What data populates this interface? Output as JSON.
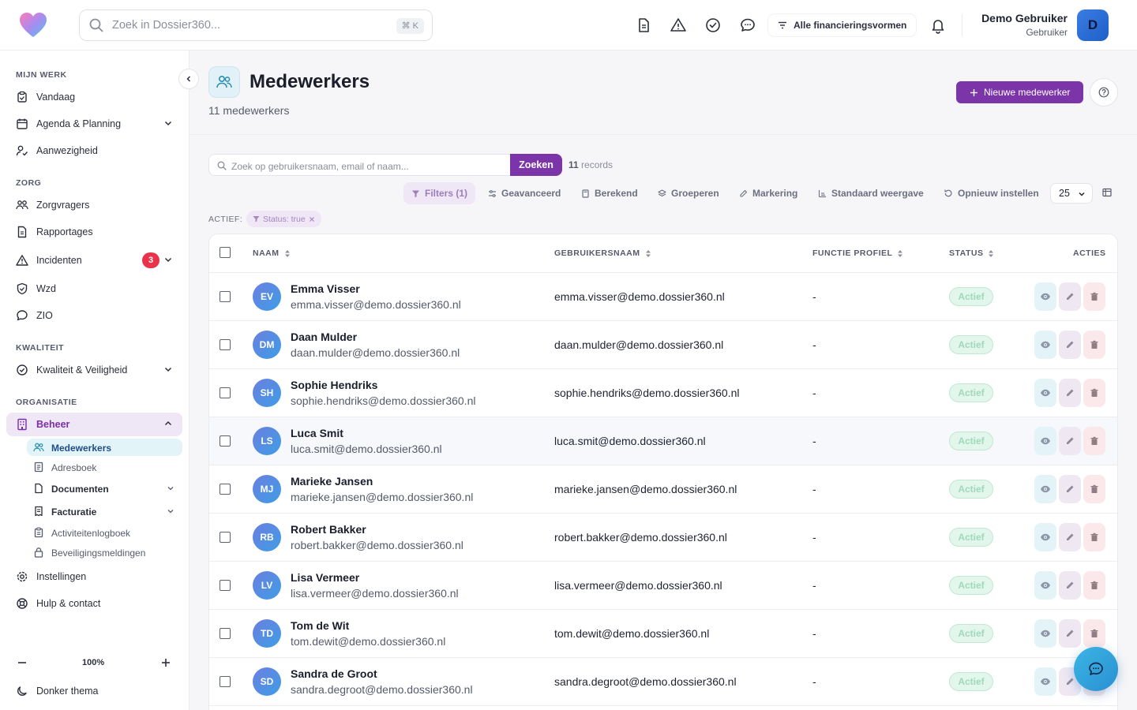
{
  "header": {
    "search_placeholder": "Zoek in Dossier360...",
    "search_shortcut": "⌘ K",
    "financing_label": "Alle financieringsvormen",
    "user_name": "Demo Gebruiker",
    "user_role": "Gebruiker",
    "user_initial": "D"
  },
  "sidebar": {
    "sections": {
      "mijn_werk": "MIJN WERK",
      "zorg": "ZORG",
      "kwaliteit": "KWALITEIT",
      "organisatie": "ORGANISATIE"
    },
    "items": {
      "vandaag": "Vandaag",
      "agenda": "Agenda & Planning",
      "aanwezigheid": "Aanwezigheid",
      "zorgvragers": "Zorgvragers",
      "rapportages": "Rapportages",
      "incidenten": "Incidenten",
      "incidenten_badge": "3",
      "wzd": "Wzd",
      "zio": "ZIO",
      "kwaliteit": "Kwaliteit & Veiligheid",
      "beheer": "Beheer",
      "instellingen": "Instellingen",
      "hulp": "Hulp & contact"
    },
    "sub_items": {
      "medewerkers": "Medewerkers",
      "adresboek": "Adresboek",
      "documenten": "Documenten",
      "facturatie": "Facturatie",
      "activiteiten": "Activiteitenlogboek",
      "beveiliging": "Beveiligingsmeldingen"
    },
    "zoom": "100%",
    "dark_theme": "Donker thema"
  },
  "page": {
    "title": "Medewerkers",
    "subtitle": "11 medewerkers",
    "new_button": "Nieuwe medewerker"
  },
  "toolbar": {
    "search_placeholder": "Zoek op gebruikersnaam, email of naam...",
    "search_button": "Zoeken",
    "records_count": "11",
    "records_label": "records",
    "filters": "Filters (1)",
    "geavanceerd": "Geavanceerd",
    "berekend": "Berekend",
    "groeperen": "Groeperen",
    "markering": "Markering",
    "standaard": "Standaard weergave",
    "opnieuw": "Opnieuw instellen",
    "page_size": "25",
    "active_label": "ACTIEF:",
    "active_chip": "Status: true"
  },
  "table": {
    "columns": {
      "naam": "NAAM",
      "gebruikersnaam": "GEBRUIKERSNAAM",
      "functie": "FUNCTIE PROFIEL",
      "status": "STATUS",
      "acties": "ACTIES"
    },
    "rows": [
      {
        "initials": "EV",
        "name": "Emma Visser",
        "email": "emma.visser@demo.dossier360.nl",
        "username": "emma.visser@demo.dossier360.nl",
        "function": "-",
        "status": "Actief"
      },
      {
        "initials": "DM",
        "name": "Daan Mulder",
        "email": "daan.mulder@demo.dossier360.nl",
        "username": "daan.mulder@demo.dossier360.nl",
        "function": "-",
        "status": "Actief"
      },
      {
        "initials": "SH",
        "name": "Sophie Hendriks",
        "email": "sophie.hendriks@demo.dossier360.nl",
        "username": "sophie.hendriks@demo.dossier360.nl",
        "function": "-",
        "status": "Actief"
      },
      {
        "initials": "LS",
        "name": "Luca Smit",
        "email": "luca.smit@demo.dossier360.nl",
        "username": "luca.smit@demo.dossier360.nl",
        "function": "-",
        "status": "Actief"
      },
      {
        "initials": "MJ",
        "name": "Marieke Jansen",
        "email": "marieke.jansen@demo.dossier360.nl",
        "username": "marieke.jansen@demo.dossier360.nl",
        "function": "-",
        "status": "Actief"
      },
      {
        "initials": "RB",
        "name": "Robert Bakker",
        "email": "robert.bakker@demo.dossier360.nl",
        "username": "robert.bakker@demo.dossier360.nl",
        "function": "-",
        "status": "Actief"
      },
      {
        "initials": "LV",
        "name": "Lisa Vermeer",
        "email": "lisa.vermeer@demo.dossier360.nl",
        "username": "lisa.vermeer@demo.dossier360.nl",
        "function": "-",
        "status": "Actief"
      },
      {
        "initials": "TD",
        "name": "Tom de Wit",
        "email": "tom.dewit@demo.dossier360.nl",
        "username": "tom.dewit@demo.dossier360.nl",
        "function": "-",
        "status": "Actief"
      },
      {
        "initials": "SD",
        "name": "Sandra de Groot",
        "email": "sandra.degroot@demo.dossier360.nl",
        "username": "sandra.degroot@demo.dossier360.nl",
        "function": "-",
        "status": "Actief"
      }
    ]
  },
  "colors": {
    "brand_purple": "#7b35a8",
    "status_green": "#e2f6ec",
    "badge_red": "#e8344a"
  }
}
